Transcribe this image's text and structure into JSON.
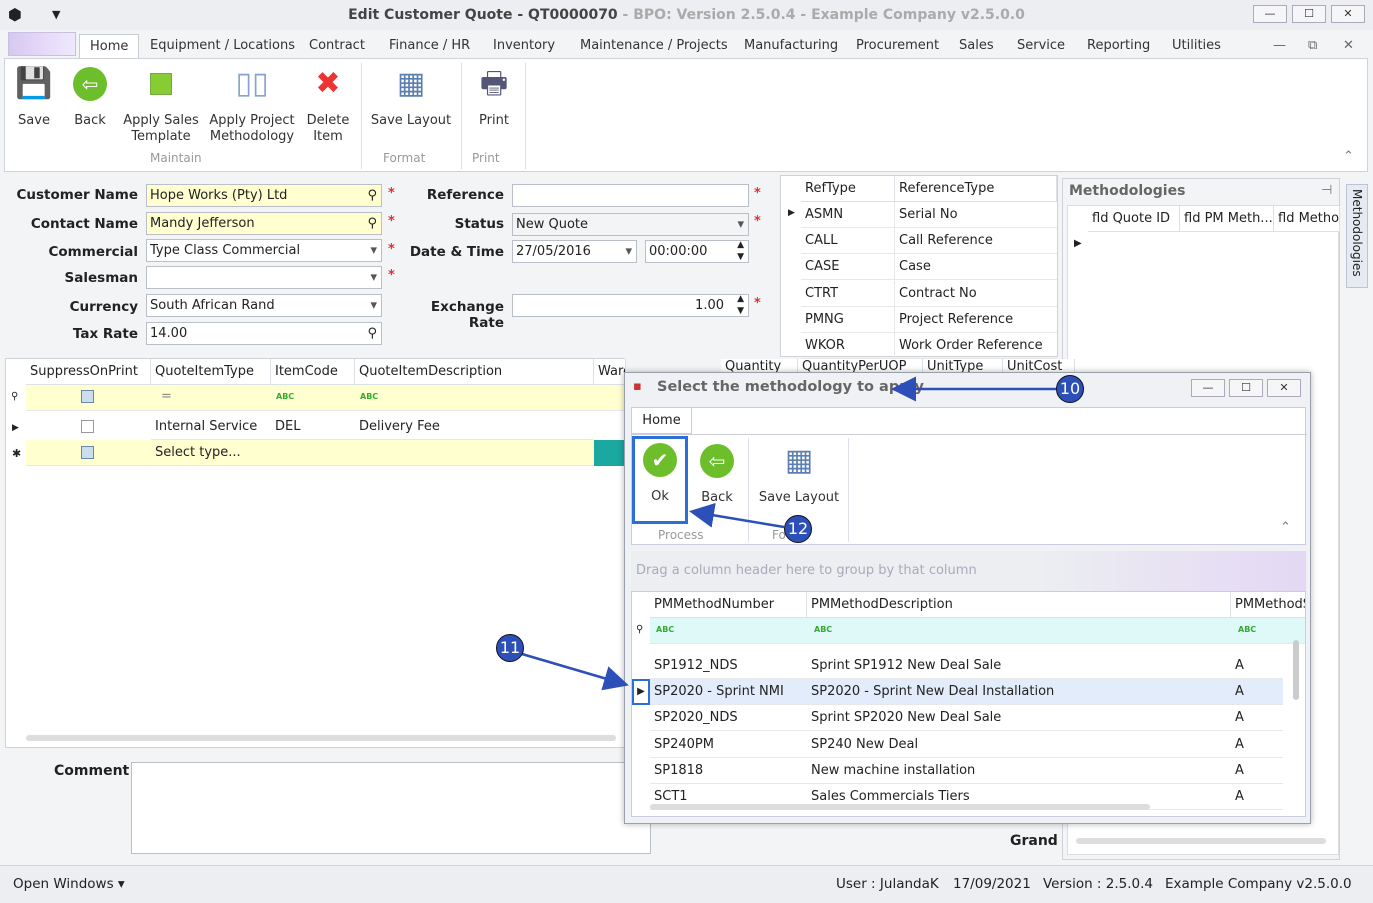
{
  "window": {
    "title": "Edit Customer Quote - QT0000070",
    "subtitle": " - BPO: Version 2.5.0.4 - Example Company v2.5.0.0",
    "min": "—",
    "max": "☐",
    "close": "✕"
  },
  "menu_tabs": [
    "Home",
    "Equipment / Locations",
    "Contract",
    "Finance / HR",
    "Inventory",
    "Maintenance / Projects",
    "Manufacturing",
    "Procurement",
    "Sales",
    "Service",
    "Reporting",
    "Utilities"
  ],
  "ribbon": {
    "buttons": [
      {
        "label": "Save",
        "icon": "floppy-icon"
      },
      {
        "label": "Back",
        "icon": "back-arrow-icon"
      },
      {
        "label": "Apply Sales\nTemplate",
        "icon": "template-icon"
      },
      {
        "label": "Apply Project\nMethodology",
        "icon": "methodology-icon"
      },
      {
        "label": "Delete\nItem",
        "icon": "delete-x-icon"
      },
      {
        "label": "Save Layout",
        "icon": "layout-icon"
      },
      {
        "label": "Print",
        "icon": "printer-icon"
      }
    ],
    "groups": [
      "Maintain",
      "Format",
      "Print"
    ]
  },
  "form": {
    "customer_name_label": "Customer Name",
    "customer_name": "Hope Works (Pty) Ltd",
    "contact_name_label": "Contact Name",
    "contact_name": "Mandy Jefferson",
    "commercial_label": "Commercial",
    "commercial": "Type Class Commercial",
    "salesman_label": "Salesman",
    "salesman": "",
    "currency_label": "Currency",
    "currency": "South African Rand",
    "tax_rate_label": "Tax Rate",
    "tax_rate": "14.00",
    "reference_label": "Reference",
    "reference": "",
    "status_label": "Status",
    "status": "New Quote",
    "datetime_label": "Date & Time",
    "date": "27/05/2016",
    "time": "00:00:00",
    "exchange_rate_label": "Exchange Rate",
    "exchange_rate": "1.00",
    "required": "*"
  },
  "ref_table": {
    "headers": [
      "RefType",
      "ReferenceType"
    ],
    "rows": [
      [
        "ASMN",
        "Serial No"
      ],
      [
        "CALL",
        "Call Reference"
      ],
      [
        "CASE",
        "Case"
      ],
      [
        "CTRT",
        "Contract No"
      ],
      [
        "PMNG",
        "Project Reference"
      ],
      [
        "WKOR",
        "Work Order Reference"
      ]
    ]
  },
  "items_grid": {
    "headers": [
      "SuppressOnPrint",
      "QuoteItemType",
      "ItemCode",
      "QuoteItemDescription",
      "WarehouseName",
      "Quantity",
      "QuantityPerUOP",
      "UnitType",
      "UnitCost"
    ],
    "rows": [
      {
        "type": "Internal Service",
        "code": "DEL",
        "desc": "Delivery Fee"
      },
      {
        "type": "Select type...",
        "code": "",
        "desc": ""
      }
    ],
    "filter_eq": "="
  },
  "methodologies": {
    "title": "Methodologies",
    "headers": [
      "fld Quote ID",
      "fld PM Meth...",
      "fld Method"
    ],
    "side_tab": "Methodologies"
  },
  "comment": {
    "label": "Comment",
    "grand": "Grand"
  },
  "dialog": {
    "title": "Select the methodology to apply",
    "tab": "Home",
    "buttons": [
      "Ok",
      "Back",
      "Save Layout"
    ],
    "groups": [
      "Process",
      "Fo"
    ],
    "group_hint": "Drag a column header here to group by that column",
    "headers": [
      "PMMethodNumber",
      "PMMethodDescription",
      "PMMethodS"
    ],
    "rows": [
      [
        "SP1912_NDS",
        "Sprint SP1912 New Deal Sale",
        "A"
      ],
      [
        "SP2020 - Sprint NMI",
        "SP2020 - Sprint New Deal Installation",
        "A"
      ],
      [
        "SP2020_NDS",
        "Sprint SP2020 New Deal Sale",
        "A"
      ],
      [
        "SP240PM",
        "SP240 New Deal",
        "A"
      ],
      [
        "SP1818",
        "New machine installation",
        "A"
      ],
      [
        "SCT1",
        "Sales Commercials Tiers",
        "A"
      ]
    ],
    "selected_row": 1
  },
  "annotations": [
    "10",
    "11",
    "12"
  ],
  "status": {
    "open_windows": "Open Windows ▾",
    "user": "User : JulandaK",
    "date": "17/09/2021",
    "version": "Version : 2.5.0.4",
    "company": "Example Company v2.5.0.0"
  },
  "colors": {
    "accent": "#2c4fb8",
    "required": "#e03030",
    "highlight": "#ffffd0",
    "selected_row": "#e3ecfa"
  }
}
